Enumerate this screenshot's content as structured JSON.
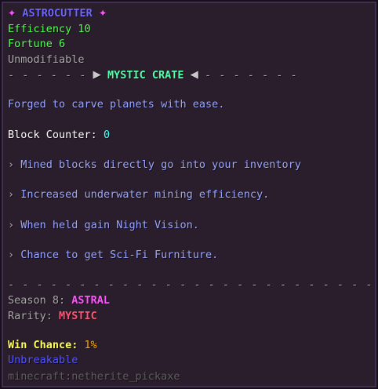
{
  "item": {
    "star_glyph": "✦",
    "name": "ASTROCUTTER",
    "enchantments": [
      "Efficiency 10",
      "Fortune 6"
    ],
    "modifier": "Unmodifiable"
  },
  "crate_divider": {
    "dashes_left": "- - - - - -",
    "arrow_right": "▶",
    "label": "MYSTIC CRATE",
    "arrow_left": "◀",
    "dashes_right": "- - - - - - -"
  },
  "description": "Forged to carve planets with ease.",
  "block_counter": {
    "label": "Block Counter:",
    "value": "0"
  },
  "perks": [
    {
      "bullet": "›",
      "text": "Mined blocks directly go into your inventory"
    },
    {
      "bullet": "›",
      "text": "Increased underwater mining efficiency."
    },
    {
      "bullet": "›",
      "text": "When held gain Night Vision."
    },
    {
      "bullet": "›",
      "text": "Chance to get Sci-Fi Furniture."
    }
  ],
  "separator": "- - - - - - - - - - - - - - - - - - - - - - - - - -",
  "season": {
    "label": "Season 8:",
    "value": "ASTRAL"
  },
  "rarity": {
    "label": "Rarity:",
    "value": "MYSTIC"
  },
  "win_chance": {
    "label": "Win Chance:",
    "value": "1%"
  },
  "unbreakable": "Unbreakable",
  "item_id": "minecraft:netherite_pickaxe",
  "colors": {
    "background": "#2a1e2c",
    "border": "#3f2f52",
    "title": "#6e66ff",
    "star": "#ff55ff",
    "enchant": "#55ff55",
    "crate": "#55ffaa",
    "lore": "#9aa6ff",
    "season": "#ff55ff",
    "rarity": "#ff5577",
    "win_chance": "#ffff55",
    "win_value": "#ffaa00",
    "unbreakable": "#5555ff"
  }
}
